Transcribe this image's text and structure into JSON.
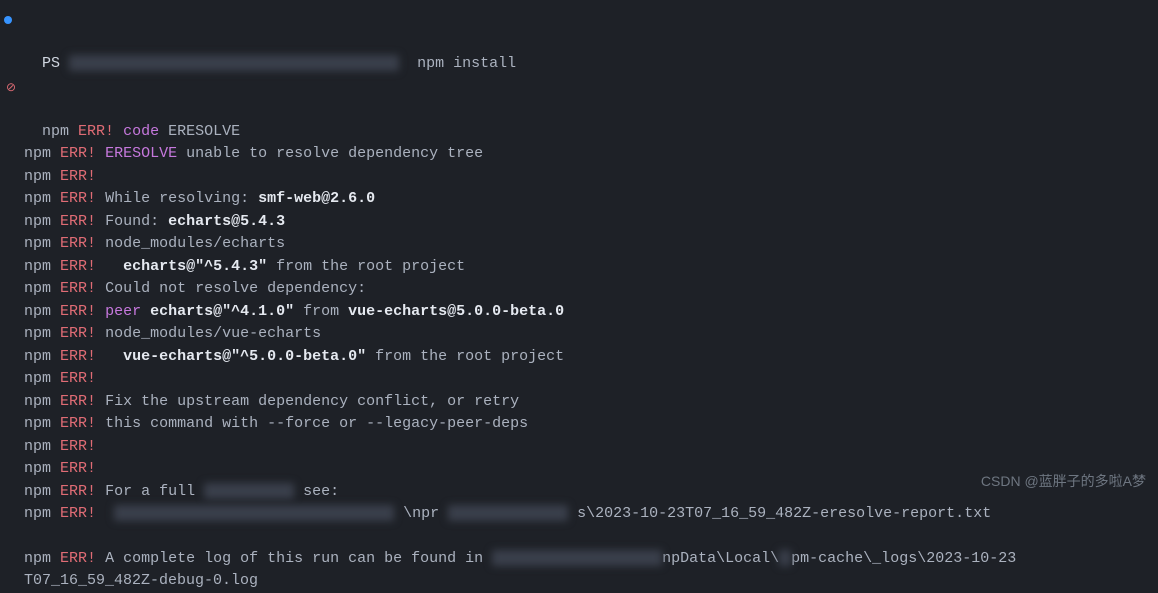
{
  "prompt": {
    "ps": "PS",
    "command": "npm install"
  },
  "lines": [
    {
      "npm": "npm",
      "err": "ERR!",
      "code_kw": "code",
      "code_val": "ERESOLVE"
    },
    {
      "npm": "npm",
      "err": "ERR!",
      "eresolve": "ERESOLVE",
      "msg": "unable to resolve dependency tree"
    },
    {
      "npm": "npm",
      "err": "ERR!"
    },
    {
      "npm": "npm",
      "err": "ERR!",
      "pre": "While resolving: ",
      "bold": "smf-web@2.6.0"
    },
    {
      "npm": "npm",
      "err": "ERR!",
      "pre": "Found: ",
      "bold": "echarts@5.4.3"
    },
    {
      "npm": "npm",
      "err": "ERR!",
      "msg": "node_modules/echarts"
    },
    {
      "npm": "npm",
      "err": "ERR!",
      "pre": "  ",
      "bold": "echarts@\"^5.4.3\"",
      "post": " from the root project"
    },
    {
      "npm": "npm",
      "err": "ERR!",
      "msg": "Could not resolve dependency:"
    },
    {
      "npm": "npm",
      "err": "ERR!",
      "peer": "peer",
      "bold": "echarts@\"^4.1.0\"",
      "mid": " from ",
      "bold2": "vue-echarts@5.0.0-beta.0"
    },
    {
      "npm": "npm",
      "err": "ERR!",
      "msg": "node_modules/vue-echarts"
    },
    {
      "npm": "npm",
      "err": "ERR!",
      "pre": "  ",
      "bold": "vue-echarts@\"^5.0.0-beta.0\"",
      "post": " from the root project"
    },
    {
      "npm": "npm",
      "err": "ERR!"
    },
    {
      "npm": "npm",
      "err": "ERR!",
      "msg": "Fix the upstream dependency conflict, or retry"
    },
    {
      "npm": "npm",
      "err": "ERR!",
      "msg": "this command with --force or --legacy-peer-deps"
    },
    {
      "npm": "npm",
      "err": "ERR!"
    },
    {
      "npm": "npm",
      "err": "ERR!"
    },
    {
      "npm": "npm",
      "err": "ERR!",
      "pre": "For a full ",
      "blur_post": "see:"
    },
    {
      "npm": "npm",
      "err": "ERR!",
      "report": "s\\2023-10-23T07_16_59_482Z-eresolve-report.txt"
    },
    {
      "npm": "npm",
      "err": "ERR!",
      "msg": "A complete log of this run can be found in",
      "log_mid": "npData\\Local\\",
      "log_end": "pm-cache\\_logs\\2023-10-23"
    },
    {
      "cont": "T07_16_59_482Z-debug-0.log"
    }
  ],
  "watermark": "CSDN @蓝胖子的多啦A梦"
}
